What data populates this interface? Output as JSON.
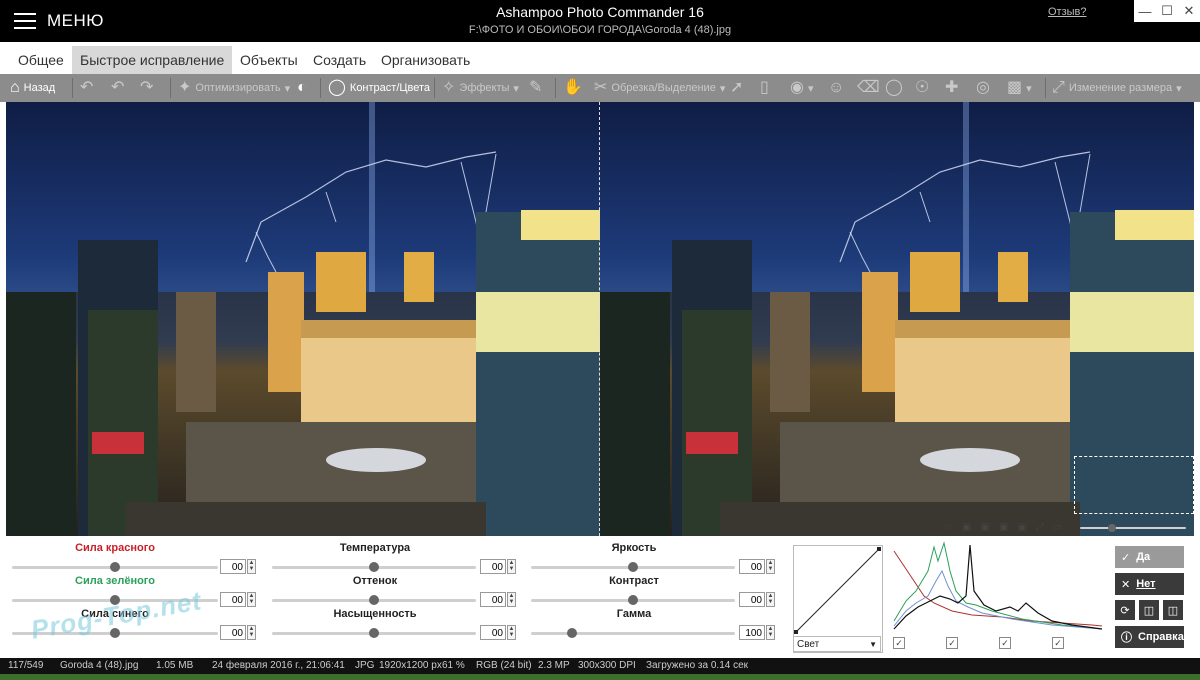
{
  "titlebar": {
    "menu_label": "МЕНЮ",
    "app_title": "Ashampoo Photo Commander 16",
    "file_path": "F:\\ФОТО И ОБОИ\\ОБОИ ГОРОДА\\Goroda 4  (48).jpg",
    "feedback_link": "Отзыв?",
    "window_buttons": [
      "minimize",
      "maximize",
      "close"
    ]
  },
  "tabs": [
    {
      "label": "Общее"
    },
    {
      "label": "Быстрое исправление",
      "active": true
    },
    {
      "label": "Объекты"
    },
    {
      "label": "Создать"
    },
    {
      "label": "Организовать"
    }
  ],
  "toolbar": {
    "back_label": "Назад",
    "optimize_label": "Оптимизировать",
    "contrast_label": "Контраст/Цвета",
    "effects_label": "Эффекты",
    "crop_label": "Обрезка/Выделение",
    "resize_label": "Изменение размера"
  },
  "sliders": {
    "red": {
      "label": "Сила красного",
      "value": "00",
      "level": 0.5
    },
    "green": {
      "label": "Сила зелёного",
      "value": "00",
      "level": 0.5
    },
    "blue": {
      "label": "Сила синего",
      "value": "00",
      "level": 0.5
    },
    "temperature": {
      "label": "Температура",
      "value": "00",
      "level": 0.5
    },
    "tint": {
      "label": "Оттенок",
      "value": "00",
      "level": 0.5
    },
    "saturation": {
      "label": "Насыщенность",
      "value": "00",
      "level": 0.5
    },
    "brightness": {
      "label": "Яркость",
      "value": "00",
      "level": 0.5
    },
    "contrast": {
      "label": "Контраст",
      "value": "00",
      "level": 0.5
    },
    "gamma": {
      "label": "Гамма",
      "value": "100",
      "level": 0.2
    }
  },
  "curve": {
    "channel": "Свет"
  },
  "actions": {
    "yes_label": "Да",
    "no_label": "Нет",
    "help_label": "Справка"
  },
  "statusbar": {
    "index": "117/549",
    "filename": "Goroda 4  (48).jpg",
    "filesize": "1.05 MB",
    "date": "24 февраля 2016 г., 21:06:41",
    "format": "JPG",
    "dimensions": "1920x1200 px",
    "zoom": "61 %",
    "color": "RGB (24 bit)",
    "megapixels": "2.3 MP",
    "dpi": "300x300 DPI",
    "load_time": "Загружено за 0.14 сек"
  },
  "watermark": "Prog-Top.net",
  "colors": {
    "red_label": "#c8202a",
    "green_label": "#2aa05a",
    "toolbar_bg": "#8c8c8c",
    "title_bg": "#000000"
  }
}
